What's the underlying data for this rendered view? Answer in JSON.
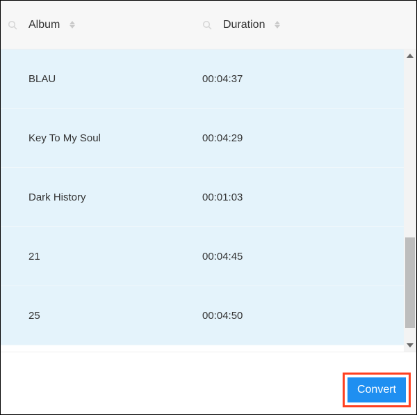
{
  "headers": {
    "album": "Album",
    "duration": "Duration"
  },
  "rows": [
    {
      "album": "BLAU",
      "duration": "00:04:37"
    },
    {
      "album": "Key To My Soul",
      "duration": "00:04:29"
    },
    {
      "album": "Dark History",
      "duration": "00:01:03"
    },
    {
      "album": "21",
      "duration": "00:04:45"
    },
    {
      "album": "25",
      "duration": "00:04:50"
    }
  ],
  "footer": {
    "convert": "Convert"
  }
}
